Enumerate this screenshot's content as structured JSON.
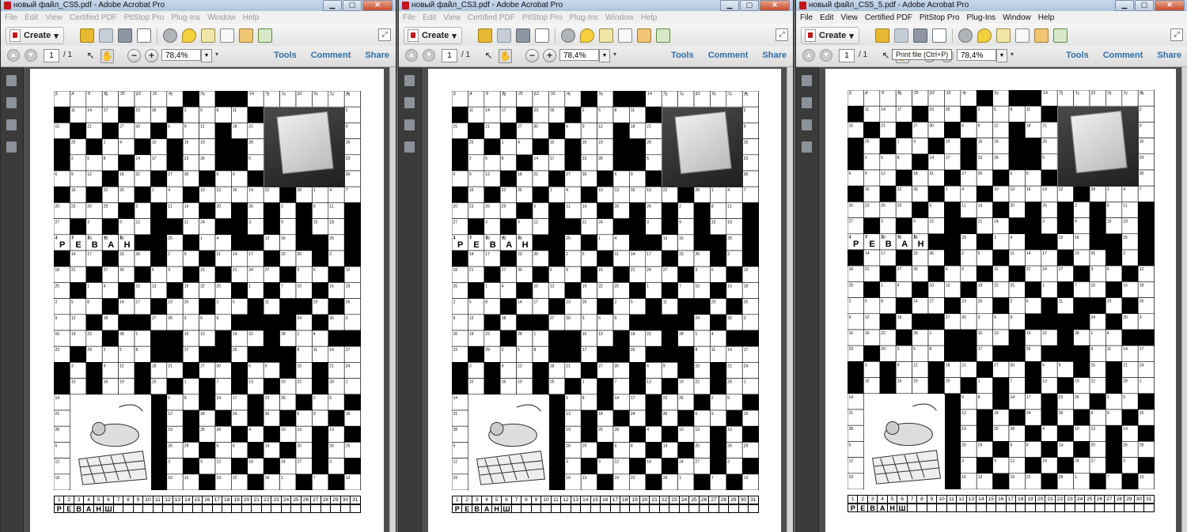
{
  "windows": [
    {
      "title": "новый файл_CS5.pdf - Adobe Acrobat Pro",
      "menu_dim": true,
      "tooltip": ""
    },
    {
      "title": "новый файл_CS3.pdf - Adobe Acrobat Pro",
      "menu_dim": true,
      "tooltip": ""
    },
    {
      "title": "новый файл_CS5_5.pdf - Adobe Acrobat Pro",
      "menu_dim": false,
      "tooltip": "Print file (Ctrl+P)"
    }
  ],
  "menu": [
    "File",
    "Edit",
    "View",
    "Certified PDF",
    "PitStop Pro",
    "Plug-Ins",
    "Window",
    "Help"
  ],
  "toolbar": {
    "create_label": "Create",
    "page_current": "1",
    "page_total": "/ 1",
    "zoom": "78,4%"
  },
  "tabs": [
    "Tools",
    "Comment",
    "Share"
  ],
  "crossword": {
    "answer_word": "РЕВАНШ",
    "answer_numbers": [
      "1",
      "2",
      "3",
      "4",
      "5",
      "6"
    ],
    "top_row_numbers": [
      "1",
      "4",
      "8",
      "8",
      "25",
      "12",
      "10",
      "4",
      "",
      "5",
      "",
      "",
      "14",
      "7",
      "1",
      "11",
      "9",
      "1",
      "4"
    ],
    "key_numbers": [
      "1",
      "2",
      "3",
      "4",
      "5",
      "6",
      "7",
      "8",
      "9",
      "10",
      "11",
      "12",
      "13",
      "14",
      "15",
      "16",
      "17",
      "18",
      "19",
      "20",
      "21",
      "22",
      "23",
      "24",
      "25",
      "26",
      "27",
      "28",
      "29",
      "30",
      "31"
    ],
    "key_letters": [
      "Р",
      "Е",
      "В",
      "А",
      "Н",
      "Ш"
    ],
    "black_cells": [
      [
        0,
        8
      ],
      [
        0,
        10
      ],
      [
        0,
        11
      ],
      [
        1,
        0
      ],
      [
        1,
        4
      ],
      [
        1,
        7
      ],
      [
        1,
        12
      ],
      [
        2,
        1
      ],
      [
        2,
        3
      ],
      [
        2,
        6
      ],
      [
        2,
        10
      ],
      [
        3,
        0
      ],
      [
        3,
        2
      ],
      [
        3,
        5
      ],
      [
        3,
        7
      ],
      [
        3,
        10
      ],
      [
        3,
        11
      ],
      [
        4,
        0
      ],
      [
        4,
        4
      ],
      [
        4,
        7
      ],
      [
        4,
        10
      ],
      [
        4,
        11
      ],
      [
        5,
        3
      ],
      [
        5,
        6
      ],
      [
        5,
        9
      ],
      [
        5,
        12
      ],
      [
        6,
        0
      ],
      [
        6,
        2
      ],
      [
        6,
        5
      ],
      [
        6,
        8
      ],
      [
        6,
        14
      ],
      [
        7,
        4
      ],
      [
        7,
        6
      ],
      [
        7,
        9
      ],
      [
        7,
        11
      ],
      [
        7,
        13
      ],
      [
        7,
        15
      ],
      [
        7,
        18
      ],
      [
        8,
        1
      ],
      [
        8,
        3
      ],
      [
        8,
        6
      ],
      [
        8,
        7
      ],
      [
        8,
        10
      ],
      [
        8,
        11
      ],
      [
        8,
        13
      ],
      [
        8,
        15
      ],
      [
        8,
        18
      ],
      [
        9,
        5
      ],
      [
        9,
        6
      ],
      [
        9,
        8
      ],
      [
        9,
        11
      ],
      [
        9,
        12
      ],
      [
        9,
        15
      ],
      [
        9,
        16
      ],
      [
        9,
        18
      ],
      [
        10,
        0
      ],
      [
        10,
        3
      ],
      [
        10,
        6
      ],
      [
        10,
        9
      ],
      [
        10,
        13
      ],
      [
        10,
        16
      ],
      [
        10,
        18
      ],
      [
        11,
        2
      ],
      [
        11,
        5
      ],
      [
        11,
        8
      ],
      [
        11,
        10
      ],
      [
        11,
        14
      ],
      [
        11,
        17
      ],
      [
        12,
        1
      ],
      [
        12,
        4
      ],
      [
        12,
        7
      ],
      [
        12,
        11
      ],
      [
        12,
        13
      ],
      [
        12,
        16
      ],
      [
        13,
        3
      ],
      [
        13,
        6
      ],
      [
        13,
        9
      ],
      [
        13,
        12
      ],
      [
        13,
        14
      ],
      [
        13,
        15
      ],
      [
        13,
        17
      ],
      [
        14,
        2
      ],
      [
        14,
        4
      ],
      [
        14,
        5
      ],
      [
        14,
        11
      ],
      [
        14,
        12
      ],
      [
        14,
        13
      ],
      [
        14,
        14
      ],
      [
        14,
        16
      ],
      [
        15,
        3
      ],
      [
        15,
        6
      ],
      [
        15,
        7
      ],
      [
        15,
        10
      ],
      [
        15,
        13
      ],
      [
        15,
        17
      ],
      [
        15,
        18
      ],
      [
        16,
        1
      ],
      [
        16,
        6
      ],
      [
        16,
        7
      ],
      [
        16,
        9
      ],
      [
        16,
        10
      ],
      [
        16,
        12
      ],
      [
        16,
        13
      ],
      [
        16,
        14
      ],
      [
        17,
        0
      ],
      [
        17,
        2
      ],
      [
        17,
        5
      ],
      [
        17,
        8
      ],
      [
        17,
        11
      ],
      [
        17,
        14
      ],
      [
        17,
        16
      ],
      [
        18,
        0
      ],
      [
        18,
        2
      ],
      [
        18,
        5
      ],
      [
        18,
        7
      ],
      [
        18,
        9
      ],
      [
        18,
        11
      ],
      [
        18,
        13
      ],
      [
        18,
        16
      ],
      [
        19,
        3
      ],
      [
        19,
        6
      ],
      [
        19,
        9
      ],
      [
        19,
        12
      ],
      [
        19,
        15
      ],
      [
        19,
        18
      ],
      [
        20,
        6
      ],
      [
        20,
        8
      ],
      [
        20,
        10
      ],
      [
        20,
        12
      ],
      [
        20,
        14
      ],
      [
        20,
        17
      ],
      [
        21,
        6
      ],
      [
        21,
        8
      ],
      [
        21,
        11
      ],
      [
        21,
        13
      ],
      [
        21,
        16
      ],
      [
        21,
        18
      ],
      [
        22,
        6
      ],
      [
        22,
        9
      ],
      [
        22,
        12
      ],
      [
        22,
        14
      ],
      [
        22,
        16
      ],
      [
        23,
        6
      ],
      [
        23,
        8
      ],
      [
        23,
        11
      ],
      [
        23,
        13
      ],
      [
        23,
        16
      ],
      [
        23,
        18
      ],
      [
        24,
        6
      ],
      [
        24,
        9
      ],
      [
        24,
        12
      ],
      [
        24,
        15
      ],
      [
        24,
        17
      ],
      [
        25,
        7
      ],
      [
        25,
        8
      ],
      [
        25,
        11
      ],
      [
        25,
        14
      ],
      [
        25,
        16
      ]
    ]
  }
}
